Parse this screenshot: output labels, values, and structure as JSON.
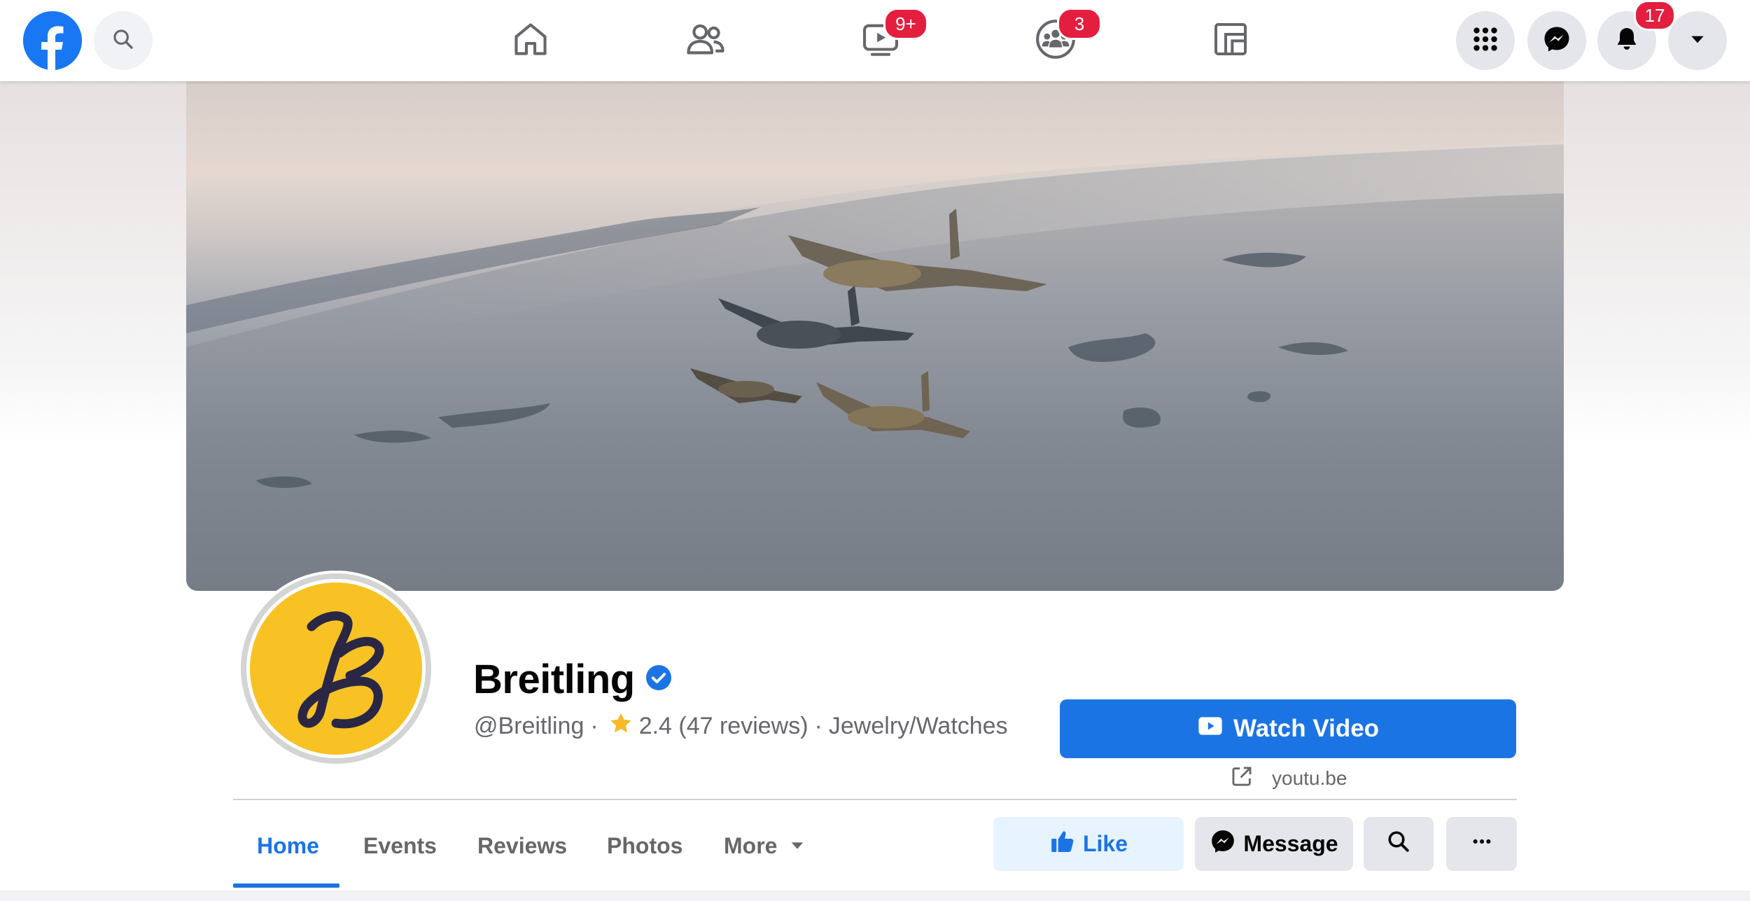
{
  "topbar": {
    "logo": "facebook-logo",
    "search_icon": "search-icon",
    "nav": [
      {
        "name": "home",
        "icon": "home-icon",
        "badge": ""
      },
      {
        "name": "friends",
        "icon": "friends-icon",
        "badge": ""
      },
      {
        "name": "watch",
        "icon": "video-icon",
        "badge": "9+"
      },
      {
        "name": "groups",
        "icon": "groups-icon",
        "badge": "3"
      },
      {
        "name": "gaming",
        "icon": "gaming-icon",
        "badge": ""
      }
    ],
    "right": {
      "menu_icon": "grid-menu-icon",
      "messenger_icon": "messenger-icon",
      "notifications_icon": "bell-icon",
      "notifications_badge": "17",
      "account_icon": "caret-down-icon"
    }
  },
  "profile": {
    "name": "Breitling",
    "verified": true,
    "handle": "@Breitling",
    "sep1": "·",
    "rating": "2.4 (47 reviews)",
    "sep2": "·",
    "category": "Jewelry/Watches",
    "cta_label": "Watch Video",
    "cta_link": "youtu.be"
  },
  "tabs": [
    {
      "label": "Home",
      "active": true
    },
    {
      "label": "Events",
      "active": false
    },
    {
      "label": "Reviews",
      "active": false
    },
    {
      "label": "Photos",
      "active": false
    },
    {
      "label": "More",
      "active": false
    }
  ],
  "actions": {
    "like_label": "Like",
    "message_label": "Message"
  },
  "colors": {
    "brand_blue": "#1b74e4",
    "badge_red": "#e41e3f",
    "avatar_gold": "#f8c224"
  }
}
